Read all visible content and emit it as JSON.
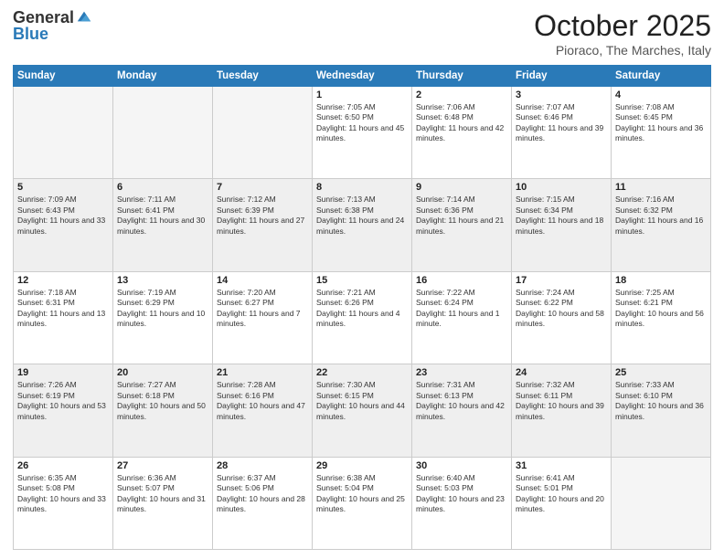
{
  "logo": {
    "general": "General",
    "blue": "Blue"
  },
  "title": "October 2025",
  "subtitle": "Pioraco, The Marches, Italy",
  "days_of_week": [
    "Sunday",
    "Monday",
    "Tuesday",
    "Wednesday",
    "Thursday",
    "Friday",
    "Saturday"
  ],
  "weeks": [
    [
      {
        "day": "",
        "info": ""
      },
      {
        "day": "",
        "info": ""
      },
      {
        "day": "",
        "info": ""
      },
      {
        "day": "1",
        "info": "Sunrise: 7:05 AM\nSunset: 6:50 PM\nDaylight: 11 hours and 45 minutes."
      },
      {
        "day": "2",
        "info": "Sunrise: 7:06 AM\nSunset: 6:48 PM\nDaylight: 11 hours and 42 minutes."
      },
      {
        "day": "3",
        "info": "Sunrise: 7:07 AM\nSunset: 6:46 PM\nDaylight: 11 hours and 39 minutes."
      },
      {
        "day": "4",
        "info": "Sunrise: 7:08 AM\nSunset: 6:45 PM\nDaylight: 11 hours and 36 minutes."
      }
    ],
    [
      {
        "day": "5",
        "info": "Sunrise: 7:09 AM\nSunset: 6:43 PM\nDaylight: 11 hours and 33 minutes."
      },
      {
        "day": "6",
        "info": "Sunrise: 7:11 AM\nSunset: 6:41 PM\nDaylight: 11 hours and 30 minutes."
      },
      {
        "day": "7",
        "info": "Sunrise: 7:12 AM\nSunset: 6:39 PM\nDaylight: 11 hours and 27 minutes."
      },
      {
        "day": "8",
        "info": "Sunrise: 7:13 AM\nSunset: 6:38 PM\nDaylight: 11 hours and 24 minutes."
      },
      {
        "day": "9",
        "info": "Sunrise: 7:14 AM\nSunset: 6:36 PM\nDaylight: 11 hours and 21 minutes."
      },
      {
        "day": "10",
        "info": "Sunrise: 7:15 AM\nSunset: 6:34 PM\nDaylight: 11 hours and 18 minutes."
      },
      {
        "day": "11",
        "info": "Sunrise: 7:16 AM\nSunset: 6:32 PM\nDaylight: 11 hours and 16 minutes."
      }
    ],
    [
      {
        "day": "12",
        "info": "Sunrise: 7:18 AM\nSunset: 6:31 PM\nDaylight: 11 hours and 13 minutes."
      },
      {
        "day": "13",
        "info": "Sunrise: 7:19 AM\nSunset: 6:29 PM\nDaylight: 11 hours and 10 minutes."
      },
      {
        "day": "14",
        "info": "Sunrise: 7:20 AM\nSunset: 6:27 PM\nDaylight: 11 hours and 7 minutes."
      },
      {
        "day": "15",
        "info": "Sunrise: 7:21 AM\nSunset: 6:26 PM\nDaylight: 11 hours and 4 minutes."
      },
      {
        "day": "16",
        "info": "Sunrise: 7:22 AM\nSunset: 6:24 PM\nDaylight: 11 hours and 1 minute."
      },
      {
        "day": "17",
        "info": "Sunrise: 7:24 AM\nSunset: 6:22 PM\nDaylight: 10 hours and 58 minutes."
      },
      {
        "day": "18",
        "info": "Sunrise: 7:25 AM\nSunset: 6:21 PM\nDaylight: 10 hours and 56 minutes."
      }
    ],
    [
      {
        "day": "19",
        "info": "Sunrise: 7:26 AM\nSunset: 6:19 PM\nDaylight: 10 hours and 53 minutes."
      },
      {
        "day": "20",
        "info": "Sunrise: 7:27 AM\nSunset: 6:18 PM\nDaylight: 10 hours and 50 minutes."
      },
      {
        "day": "21",
        "info": "Sunrise: 7:28 AM\nSunset: 6:16 PM\nDaylight: 10 hours and 47 minutes."
      },
      {
        "day": "22",
        "info": "Sunrise: 7:30 AM\nSunset: 6:15 PM\nDaylight: 10 hours and 44 minutes."
      },
      {
        "day": "23",
        "info": "Sunrise: 7:31 AM\nSunset: 6:13 PM\nDaylight: 10 hours and 42 minutes."
      },
      {
        "day": "24",
        "info": "Sunrise: 7:32 AM\nSunset: 6:11 PM\nDaylight: 10 hours and 39 minutes."
      },
      {
        "day": "25",
        "info": "Sunrise: 7:33 AM\nSunset: 6:10 PM\nDaylight: 10 hours and 36 minutes."
      }
    ],
    [
      {
        "day": "26",
        "info": "Sunrise: 6:35 AM\nSunset: 5:08 PM\nDaylight: 10 hours and 33 minutes."
      },
      {
        "day": "27",
        "info": "Sunrise: 6:36 AM\nSunset: 5:07 PM\nDaylight: 10 hours and 31 minutes."
      },
      {
        "day": "28",
        "info": "Sunrise: 6:37 AM\nSunset: 5:06 PM\nDaylight: 10 hours and 28 minutes."
      },
      {
        "day": "29",
        "info": "Sunrise: 6:38 AM\nSunset: 5:04 PM\nDaylight: 10 hours and 25 minutes."
      },
      {
        "day": "30",
        "info": "Sunrise: 6:40 AM\nSunset: 5:03 PM\nDaylight: 10 hours and 23 minutes."
      },
      {
        "day": "31",
        "info": "Sunrise: 6:41 AM\nSunset: 5:01 PM\nDaylight: 10 hours and 20 minutes."
      },
      {
        "day": "",
        "info": ""
      }
    ]
  ]
}
